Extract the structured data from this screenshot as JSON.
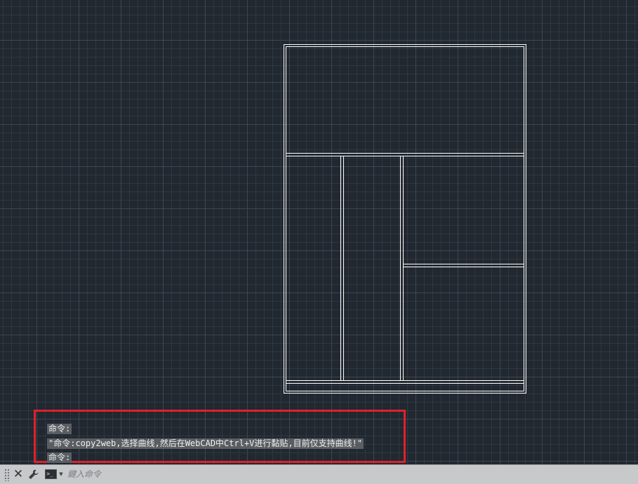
{
  "app": {
    "accent_color": "#e0212b",
    "canvas_color": "#212830",
    "drawing_color": "#ffffff"
  },
  "command_history": {
    "lines": [
      "命令:",
      "\"命令:copy2web,选择曲线,然后在WebCAD中Ctrl+V进行黏贴,目前仅支持曲线!\"",
      "命令:"
    ]
  },
  "command_bar": {
    "close_icon": "close-icon",
    "settings_icon": "wrench-icon",
    "prompt_icon": "command-prompt-icon",
    "input_placeholder": "鍵入命令",
    "input_value": ""
  }
}
